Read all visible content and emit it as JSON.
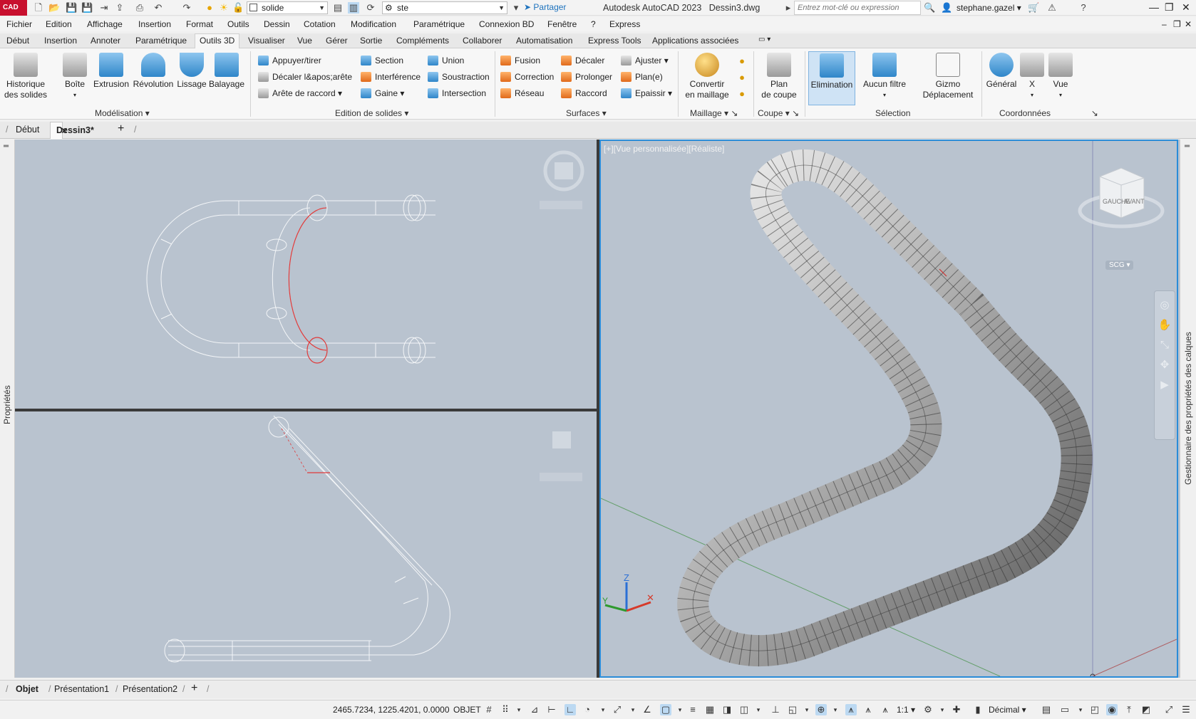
{
  "app": {
    "logo": "CAD",
    "workspace": "solide",
    "style_combo": "ste",
    "share": "Partager",
    "title": "Autodesk AutoCAD 2023",
    "filename": "Dessin3.dwg",
    "search_placeholder": "Entrez mot-clé ou expression",
    "user": "stephane.gazel"
  },
  "menu": [
    "Fichier",
    "Edition",
    "Affichage",
    "Insertion",
    "Format",
    "Outils",
    "Dessin",
    "Cotation",
    "Modification",
    "Paramétrique",
    "Connexion BD",
    "Fenêtre",
    "?",
    "Express"
  ],
  "ribbon_tabs": [
    "Début",
    "Insertion",
    "Annoter",
    "Paramétrique",
    "Outils 3D",
    "Visualiser",
    "Vue",
    "Gérer",
    "Sortie",
    "Compléments",
    "Collaborer",
    "Automatisation",
    "Express Tools",
    "Applications associées"
  ],
  "ribbon_active_tab": "Outils 3D",
  "ribbon": {
    "modelisation": {
      "label": "Modélisation",
      "historique": "Historique\ndes solides",
      "boite": "Boîte",
      "extrusion": "Extrusion",
      "revolution": "Révolution",
      "lissage": "Lissage",
      "balayage": "Balayage"
    },
    "edition": {
      "label": "Edition de solides",
      "appuyer": "Appuyer/tirer",
      "decaler_arete": "Décaler l&apos;arête",
      "arete_raccord": "Arête de raccord",
      "section": "Section",
      "interference": "Interférence",
      "gaine": "Gaine",
      "union": "Union",
      "soustraction": "Soustraction",
      "intersection": "Intersection"
    },
    "surfaces": {
      "label": "Surfaces",
      "fusion": "Fusion",
      "correction": "Correction",
      "reseau": "Réseau",
      "decaler": "Décaler",
      "prolonger": "Prolonger",
      "raccord": "Raccord",
      "ajuster": "Ajuster",
      "plan": "Plan(e)",
      "epaissir": "Epaissir"
    },
    "maillage": {
      "label": "Maillage",
      "convertir": "Convertir\nen maillage"
    },
    "coupe": {
      "label": "Coupe",
      "plan": "Plan\nde coupe"
    },
    "selection": {
      "label": "Sélection",
      "elimination": "Elimination",
      "filtre": "Aucun filtre",
      "gizmo": "Gizmo\nDéplacement"
    },
    "coordonnees": {
      "label": "Coordonnées",
      "general": "Général",
      "x": "X",
      "vue": "Vue"
    }
  },
  "doc_tabs": {
    "start": "Début",
    "active": "Dessin3*"
  },
  "viewport": {
    "label": "[+][Vue personnalisée][Réaliste]",
    "cube_gauche": "GAUCHE",
    "cube_avant": "AVANT",
    "scg": "SCG",
    "axis_z": "Z",
    "axis_y": "Y"
  },
  "side_panels": {
    "left": "Propriétés",
    "right": "Gestionnaire des propriétés des calques"
  },
  "layout_tabs": [
    "Objet",
    "Présentation1",
    "Présentation2"
  ],
  "status": {
    "coords": "2465.7234, 1225.4201, 0.0000",
    "mode": "OBJET",
    "scale": "1:1",
    "units": "Décimal"
  },
  "colors": {
    "viewport_bg": "#b9c3cf",
    "accent_blue": "#2a8cd8",
    "autocad_red": "#c8102e"
  }
}
